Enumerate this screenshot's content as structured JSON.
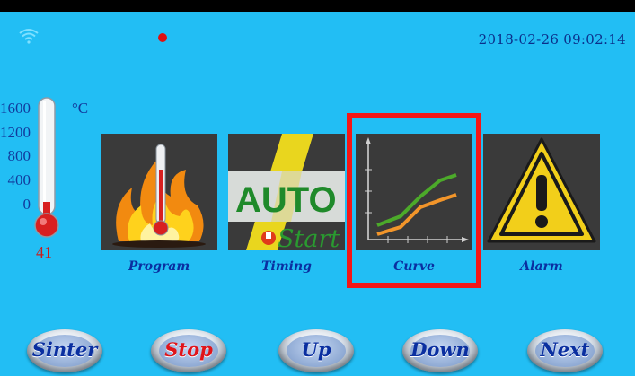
{
  "status_bar": {
    "datetime": "2018-02-26 09:02:14",
    "wifi_icon": "wifi-icon",
    "record_indicator_color": "#e01010"
  },
  "thermometer": {
    "scale": [
      "1600",
      "1200",
      "800",
      "400",
      "0"
    ],
    "unit": "°C",
    "current_value": "41",
    "current_level": 0.03
  },
  "tiles": [
    {
      "label": "Program",
      "icon": "fire-thermometer-icon"
    },
    {
      "label": "Timing",
      "icon": "auto-start-icon",
      "auto_text": "AUTO",
      "start_text": "Start"
    },
    {
      "label": "Curve",
      "icon": "curve-chart-icon",
      "highlighted": true
    },
    {
      "label": "Alarm",
      "icon": "warning-triangle-icon"
    }
  ],
  "buttons": [
    "Sinter",
    "Stop",
    "Up",
    "Down",
    "Next"
  ],
  "colors": {
    "background": "#22bef4",
    "label_text": "#0a2fa0",
    "highlight_border": "#f41616",
    "stop_text": "#e0141a"
  }
}
